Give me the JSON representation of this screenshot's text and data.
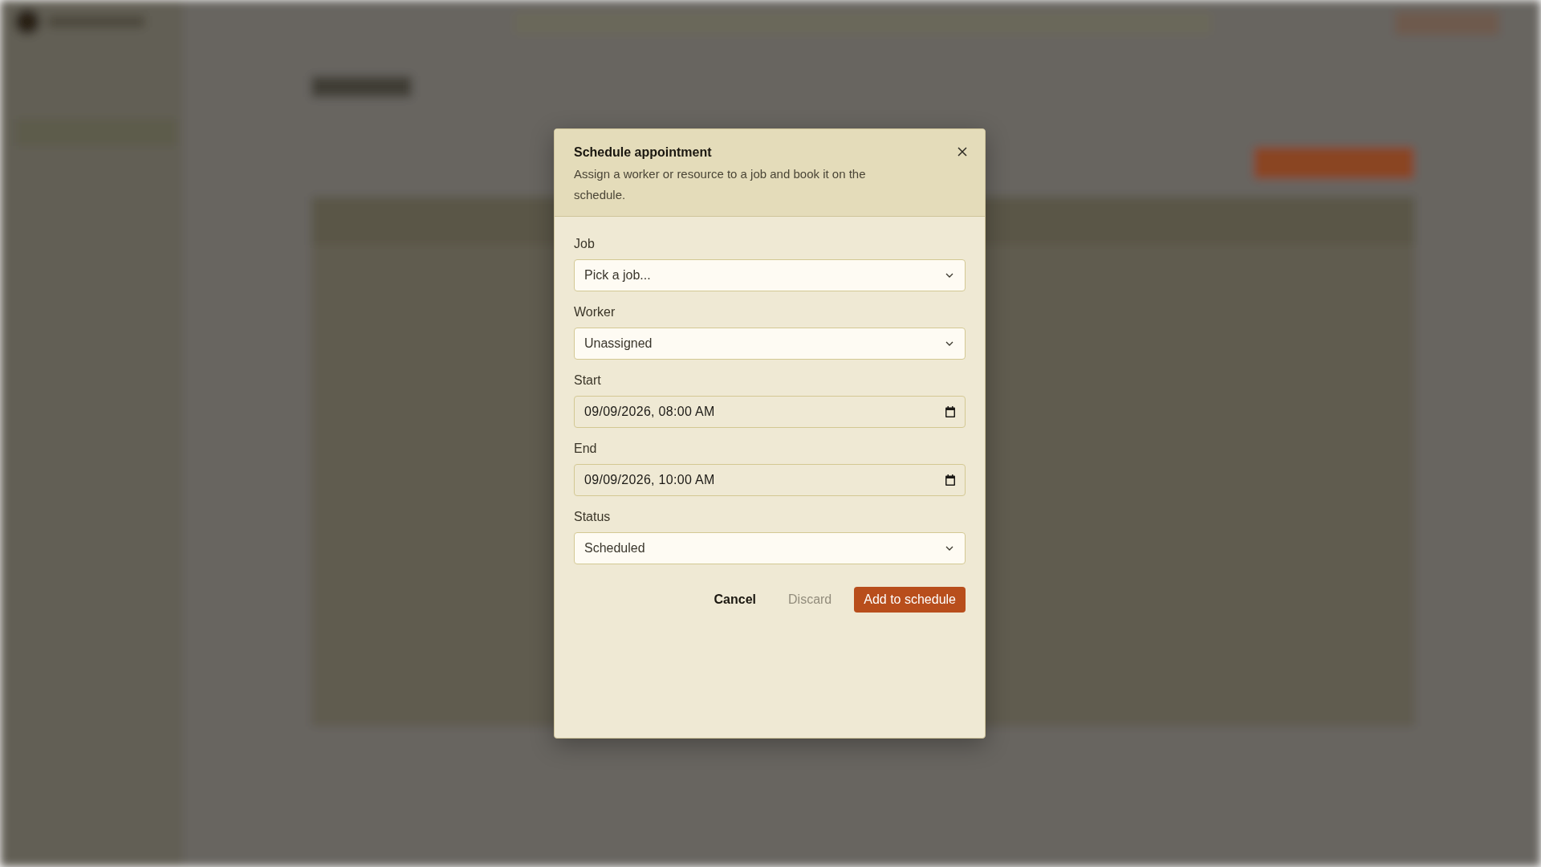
{
  "dialog": {
    "title": "Schedule appointment",
    "description": "Assign a worker or resource to a job and book it on the schedule.",
    "fields": [
      {
        "label": "Job",
        "kind": "select",
        "placeholder": "Pick a job..."
      },
      {
        "label": "Worker",
        "kind": "select",
        "value": "Unassigned"
      },
      {
        "label": "Start",
        "kind": "datetime",
        "value": "09/09/2026, 08:00 AM"
      },
      {
        "label": "End",
        "kind": "datetime",
        "value": "09/09/2026, 10:00 AM"
      },
      {
        "label": "Status",
        "kind": "select",
        "value": "Scheduled"
      }
    ],
    "buttons": [
      {
        "label": "Cancel",
        "kind": "plain",
        "disabled": false
      },
      {
        "label": "Discard",
        "kind": "plain",
        "disabled": true
      },
      {
        "label": "Add to schedule",
        "kind": "primary",
        "disabled": false
      }
    ]
  }
}
